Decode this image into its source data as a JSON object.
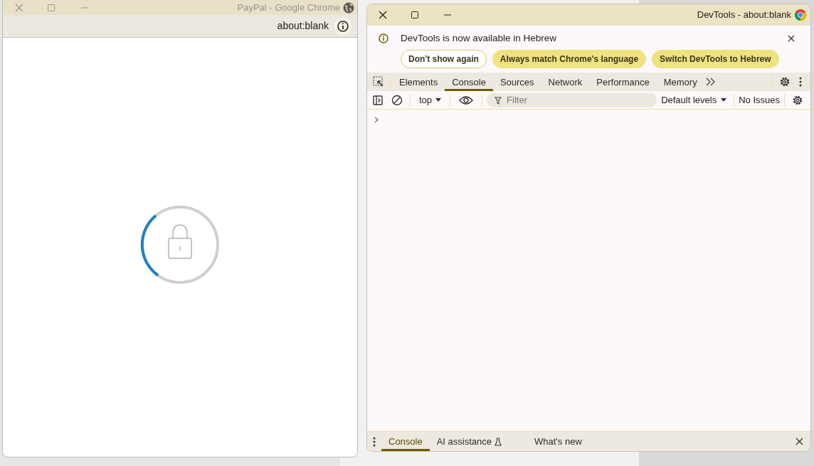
{
  "browser_window": {
    "title": "PayPal - Google Chrome",
    "address": "about:blank"
  },
  "devtools": {
    "title": "DevTools - about:blank",
    "infobar": {
      "message": "DevTools is now available in Hebrew",
      "buttons": [
        {
          "label": "Don't show again",
          "kind": "outline"
        },
        {
          "label": "Always match Chrome's language",
          "kind": "filled"
        },
        {
          "label": "Switch DevTools to Hebrew",
          "kind": "filled"
        }
      ]
    },
    "tabs": [
      {
        "label": "Elements",
        "selected": false
      },
      {
        "label": "Console",
        "selected": true
      },
      {
        "label": "Sources",
        "selected": false
      },
      {
        "label": "Network",
        "selected": false
      },
      {
        "label": "Performance",
        "selected": false
      },
      {
        "label": "Memory",
        "selected": false
      }
    ],
    "console_toolbar": {
      "context": "top",
      "filter_placeholder": "Filter",
      "levels": "Default levels",
      "issues": "No Issues"
    },
    "drawer_tabs": [
      {
        "label": "Console",
        "selected": true,
        "kind": "plain"
      },
      {
        "label": "AI assistance",
        "selected": false,
        "kind": "experimental"
      },
      {
        "label": "What's new",
        "selected": false,
        "kind": "plain"
      }
    ]
  }
}
